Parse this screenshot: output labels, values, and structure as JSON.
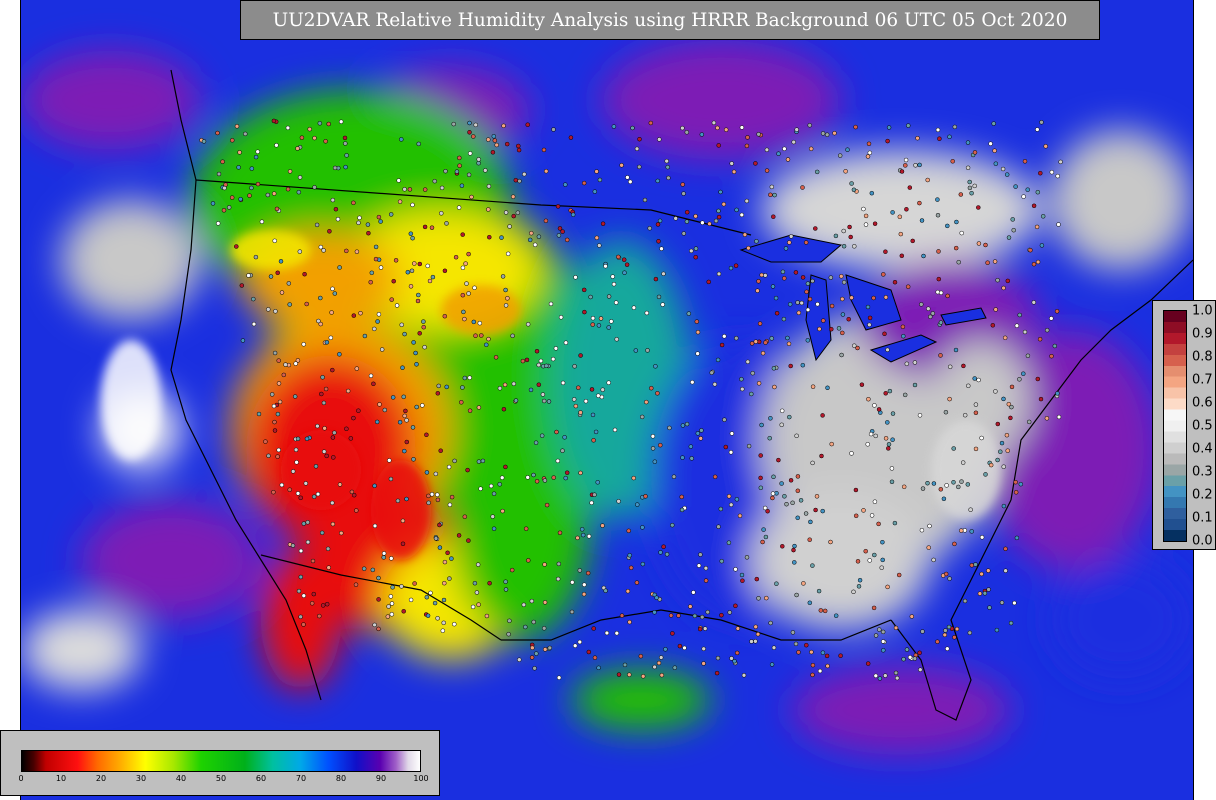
{
  "title": "UU2DVAR Relative Humidity Analysis using HRRR Background 06 UTC 05 Oct 2020",
  "colors": {
    "title_box": "#8c8c8c",
    "legend_box": "#bfbfbf",
    "ocean_deep": "#1a2fe0",
    "ocean_humid": "#7d1fb5",
    "dry_red": "#e81010",
    "orange": "#f28c00",
    "yellow": "#f5e600",
    "green": "#22c000",
    "teal": "#14a89c",
    "lightgray": "#c8c8c8"
  },
  "rh_colorbar": {
    "min": 0,
    "max": 100,
    "ticks": [
      "0",
      "10",
      "20",
      "30",
      "40",
      "50",
      "60",
      "70",
      "80",
      "90",
      "100"
    ],
    "stops": [
      {
        "value": 0,
        "color": "#000000"
      },
      {
        "value": 3,
        "color": "#4a0000"
      },
      {
        "value": 6,
        "color": "#c00000"
      },
      {
        "value": 14,
        "color": "#ff1010"
      },
      {
        "value": 19,
        "color": "#ff6a00"
      },
      {
        "value": 25,
        "color": "#ffb000"
      },
      {
        "value": 31,
        "color": "#ffff00"
      },
      {
        "value": 38,
        "color": "#a8e800"
      },
      {
        "value": 45,
        "color": "#1ed200"
      },
      {
        "value": 56,
        "color": "#00b01a"
      },
      {
        "value": 63,
        "color": "#00c0a0"
      },
      {
        "value": 70,
        "color": "#00a8e8"
      },
      {
        "value": 77,
        "color": "#0050ff"
      },
      {
        "value": 84,
        "color": "#1010c8"
      },
      {
        "value": 90,
        "color": "#5a00b0"
      },
      {
        "value": 94,
        "color": "#a060c8"
      },
      {
        "value": 97,
        "color": "#e0d8e8"
      },
      {
        "value": 100,
        "color": "#ffffff"
      }
    ]
  },
  "obs_legend": {
    "ticks": [
      "1.0",
      "0.9",
      "0.8",
      "0.7",
      "0.6",
      "0.5",
      "0.4",
      "0.3",
      "0.2",
      "0.1",
      "0.0"
    ],
    "colors_top_to_bottom": [
      "#67001f",
      "#8e0d25",
      "#b2182b",
      "#c4413f",
      "#d6604d",
      "#e58e6f",
      "#f4a582",
      "#f8c3a8",
      "#fddbc7",
      "#f7f7f7",
      "#f0f0f0",
      "#e0e0e0",
      "#cfcfcf",
      "#bababa",
      "#9aa6a6",
      "#6aa0a8",
      "#4393c3",
      "#3478b0",
      "#2f5f9e",
      "#215090",
      "#053061"
    ]
  }
}
